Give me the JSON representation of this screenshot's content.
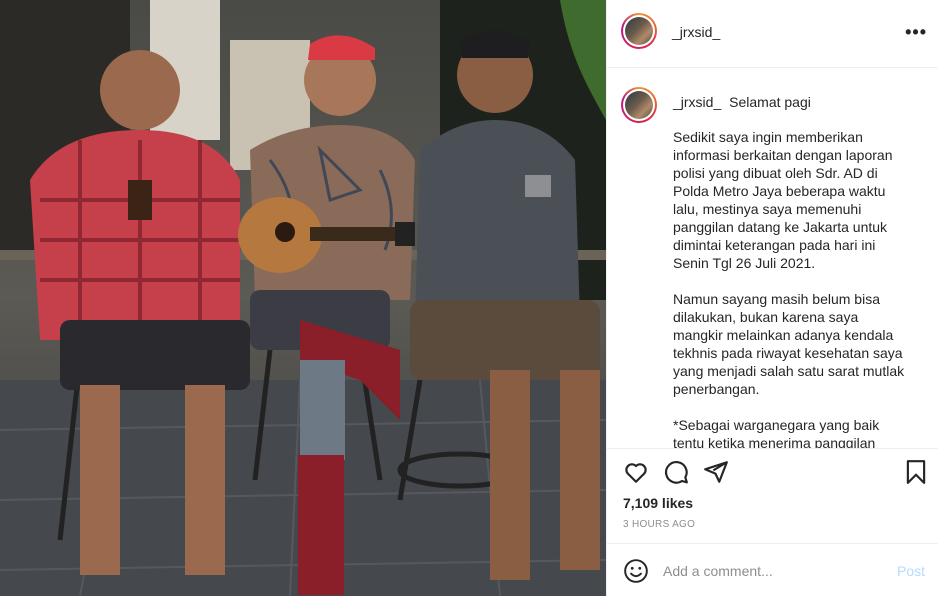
{
  "post": {
    "username": "_jrxsid_",
    "more_icon": "more-horizontal-icon",
    "caption_first_line": "Selamat pagi",
    "caption_paragraphs": [
      "Sedikit saya ingin memberikan informasi berkaitan dengan laporan polisi yang dibuat oleh Sdr. AD di Polda Metro Jaya beberapa waktu lalu, mestinya saya memenuhi panggilan datang ke Jakarta untuk dimintai keterangan pada hari ini Senin Tgl 26 Juli 2021.",
      "Namun sayang masih belum bisa dilakukan, bukan karena saya mangkir melainkan adanya kendala tekhnis pada riwayat kesehatan saya yang menjadi salah satu sarat mutlak penerbangan.",
      "*Sebagai warganegara yang baik tentu ketika menerima panggilan pada"
    ],
    "likes": "7,109 likes",
    "time": "3 HOURS AGO"
  },
  "actions": {
    "like_icon": "heart-icon",
    "comment_icon": "comment-icon",
    "share_icon": "send-icon",
    "save_icon": "bookmark-icon"
  },
  "comment_box": {
    "emoji_icon": "emoji-icon",
    "placeholder": "Add a comment...",
    "post_label": "Post"
  },
  "colors": {
    "post_button": "#b3dbff",
    "muted_text": "#8e8e8e",
    "border": "#efefef"
  }
}
